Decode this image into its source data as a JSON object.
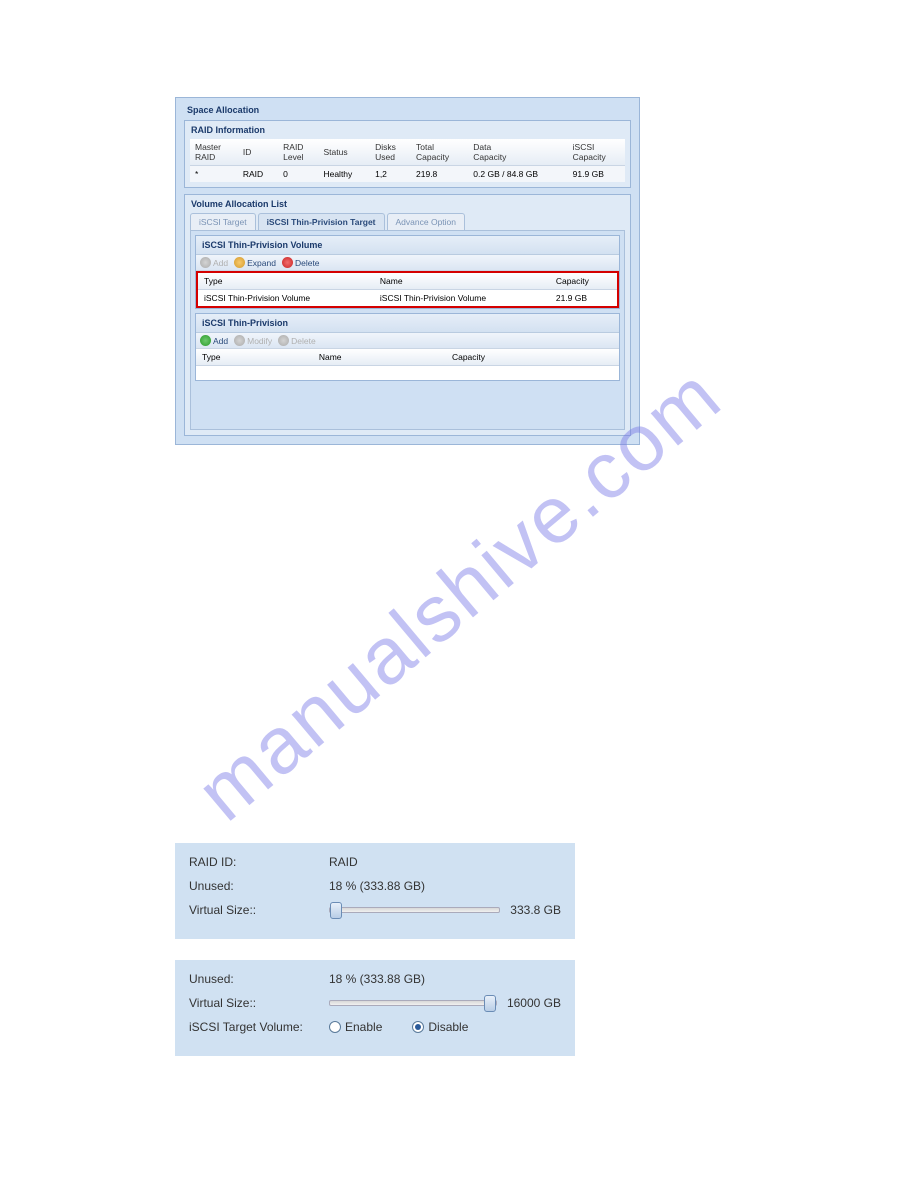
{
  "watermark": "manualshive.com",
  "app": {
    "title": "Space Allocation",
    "raid_section": {
      "title": "RAID Information",
      "headers": {
        "master_raid": "Master\nRAID",
        "id": "ID",
        "level": "RAID\nLevel",
        "status": "Status",
        "disks": "Disks\nUsed",
        "total": "Total\nCapacity",
        "data": "Data\nCapacity",
        "iscsi": "iSCSI\nCapacity"
      },
      "row": {
        "master_raid": "*",
        "id": "RAID",
        "level": "0",
        "status": "Healthy",
        "disks": "1,2",
        "total": "219.8",
        "data": "0.2 GB / 84.8 GB",
        "iscsi": "91.9 GB"
      }
    },
    "vol_section": {
      "title": "Volume Allocation List",
      "tabs": {
        "t1": "iSCSI Target",
        "t2": "iSCSI Thin-Privision Target",
        "t3": "Advance Option"
      },
      "panel1": {
        "title": "iSCSI Thin-Privision Volume",
        "btn_add": "Add",
        "btn_expand": "Expand",
        "btn_delete": "Delete",
        "cols": {
          "type": "Type",
          "name": "Name",
          "capacity": "Capacity"
        },
        "row": {
          "type": "iSCSI Thin-Privision Volume",
          "name": "iSCSI Thin-Privision Volume",
          "capacity": "21.9 GB"
        }
      },
      "panel2": {
        "title": "iSCSI Thin-Privision",
        "btn_add": "Add",
        "btn_modify": "Modify",
        "btn_delete": "Delete",
        "cols": {
          "type": "Type",
          "name": "Name",
          "capacity": "Capacity"
        }
      }
    }
  },
  "info1": {
    "raid_lbl": "RAID ID:",
    "raid_val": "RAID",
    "unused_lbl": "Unused:",
    "unused_val": "18 % (333.88 GB)",
    "vsize_lbl": "Virtual Size::",
    "vsize_val": "333.8 GB"
  },
  "info2": {
    "unused_lbl": "Unused:",
    "unused_val": "18 % (333.88 GB)",
    "vsize_lbl": "Virtual Size::",
    "vsize_val": "16000 GB",
    "tgt_lbl": "iSCSI Target Volume:",
    "enable": "Enable",
    "disable": "Disable"
  }
}
